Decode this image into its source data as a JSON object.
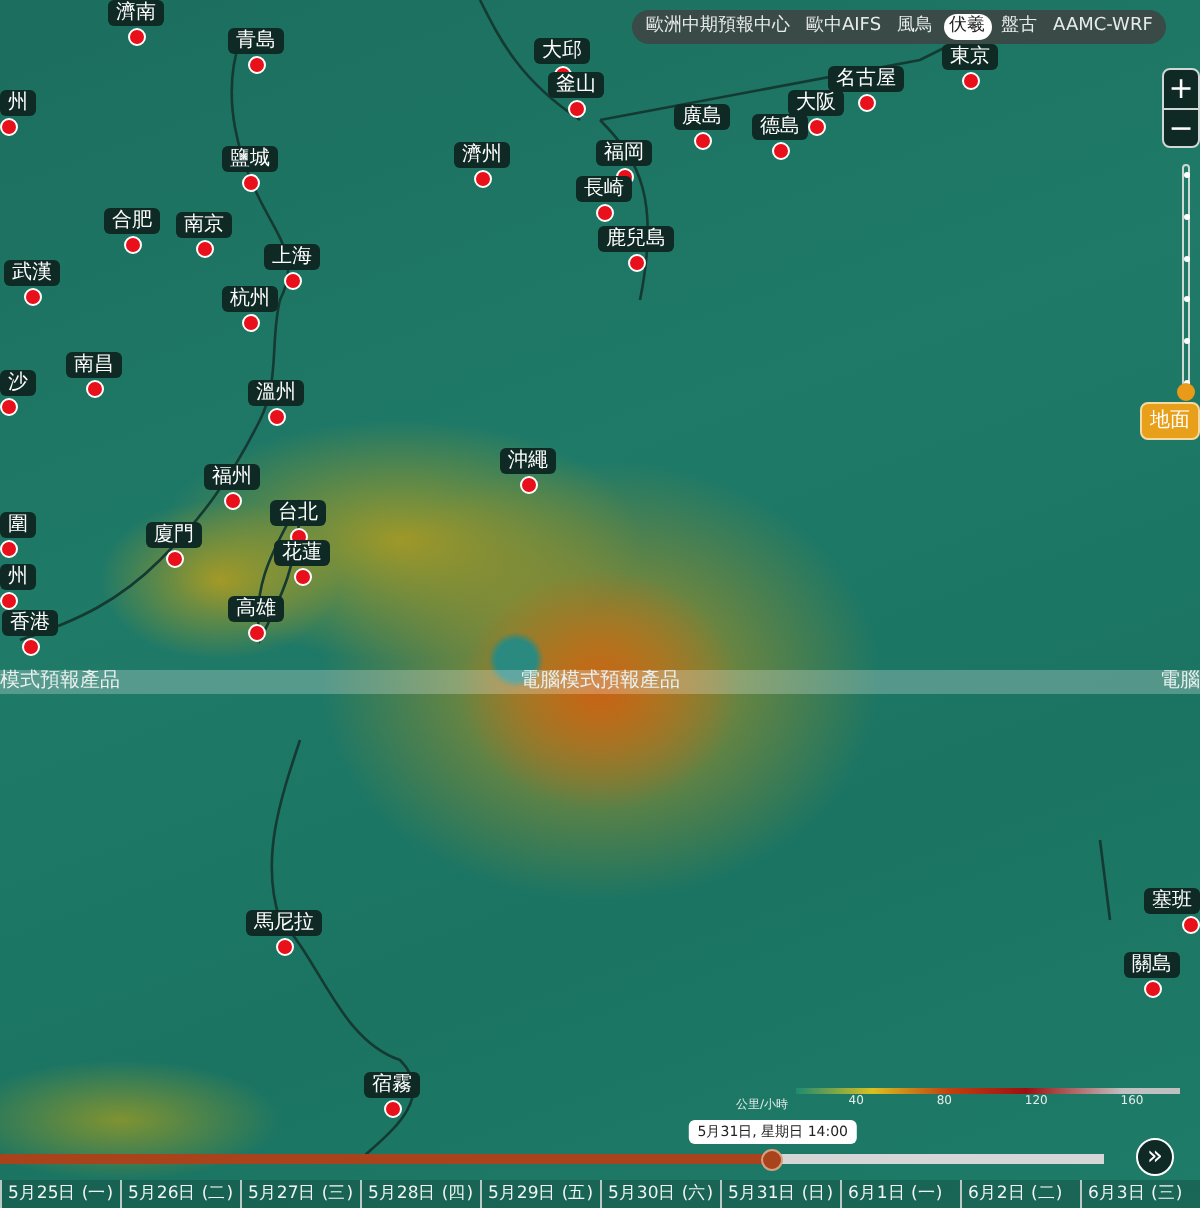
{
  "model_tabs": [
    {
      "label": "歐洲中期預報中心",
      "selected": false
    },
    {
      "label": "歐中AIFS",
      "selected": false
    },
    {
      "label": "風鳥",
      "selected": false
    },
    {
      "label": "伏羲",
      "selected": true
    },
    {
      "label": "盤古",
      "selected": false
    },
    {
      "label": "AAMC-WRF",
      "selected": false
    }
  ],
  "zoom_controls": [
    "+",
    "−"
  ],
  "altitude_slider": {
    "level": 0,
    "label": "地面"
  },
  "cities": [
    "濟南",
    "青島",
    "大邱",
    "釜山",
    "東京",
    "名古屋",
    "大阪",
    "廣島",
    "德島",
    "州",
    "鹽城",
    "濟州",
    "福岡",
    "長崎",
    "合肥",
    "南京",
    "上海",
    "武漢",
    "鹿兒島",
    "杭州",
    "南昌",
    "沙",
    "溫州",
    "沖繩",
    "福州",
    "台北",
    "圍",
    "廈門",
    "花蓮",
    "州",
    "高雄",
    "香港",
    "馬尼拉",
    "宿霧",
    "塞班",
    "關島"
  ],
  "banner_texts": [
    "模式預報產品",
    "電腦模式預報產品",
    "電腦"
  ],
  "legend": {
    "unit": "公里/小時",
    "ticks": [
      "40",
      "80",
      "120",
      "160"
    ]
  },
  "timeline": {
    "level": 0.7,
    "tooltip": "5月31日, 星期日 14:00",
    "days": [
      "5月25日 (一)",
      "5月26日 (二)",
      "5月27日 (三)",
      "5月28日 (四)",
      "5月29日 (五)",
      "5月30日 (六)",
      "5月31日 (日)",
      "6月1日 (一)",
      "6月2日 (二)",
      "6月3日 (三)"
    ]
  },
  "forward_button": "»"
}
